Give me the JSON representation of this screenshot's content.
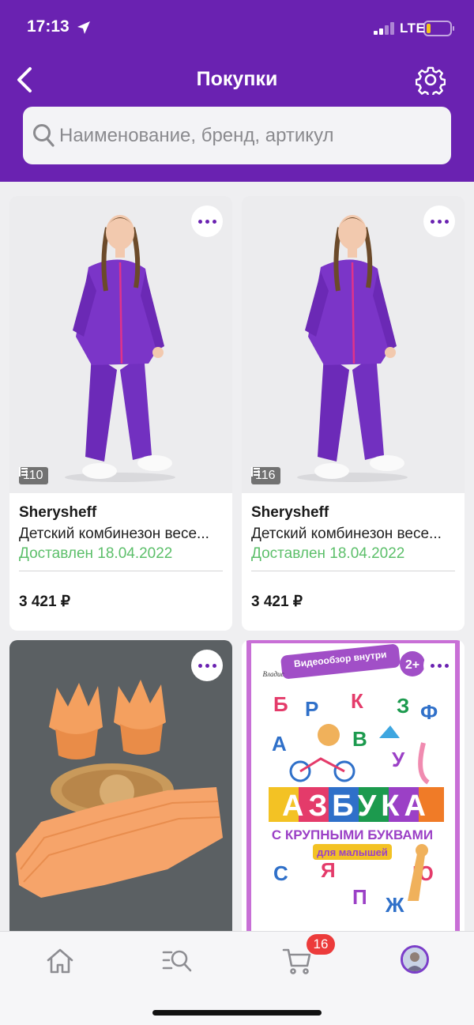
{
  "status_bar": {
    "time": "17:13",
    "network": "LTE",
    "icons": [
      "location-arrow-icon",
      "signal-icon",
      "battery-icon"
    ]
  },
  "header": {
    "title": "Покупки",
    "back_icon": "chevron-left-icon",
    "settings_icon": "gear-icon",
    "accent_color": "#6a22b1"
  },
  "search": {
    "placeholder": "Наименование, бренд, артикул",
    "value": ""
  },
  "products": [
    {
      "brand": "Sherysheff",
      "name": "Детский комбинезон весе...",
      "delivery": "Доставлен 18.04.2022",
      "size": "110",
      "price": "3 421 ₽",
      "image": "girl-purple-jumpsuit"
    },
    {
      "brand": "Sherysheff",
      "name": "Детский комбинезон весе...",
      "delivery": "Доставлен 18.04.2022",
      "size": "116",
      "price": "3 421 ₽",
      "image": "girl-purple-jumpsuit"
    },
    {
      "image": "orange-tulip-cupcake-liners"
    },
    {
      "image": "azbuka-book-cover",
      "cover": {
        "banner": "Видеообзор внутри",
        "age": "2+",
        "title": "АЗБУКА",
        "subtitle": "С КРУПНЫМИ БУКВАМИ",
        "ribbon": "для малышей",
        "publisher": "Владис"
      }
    }
  ],
  "tab_bar": {
    "tabs": [
      "home-icon",
      "catalog-search-icon",
      "cart-icon",
      "profile-avatar"
    ],
    "cart_count": "16",
    "badge_color": "#ec3b3b"
  },
  "colors": {
    "delivered": "#5cbf6a",
    "background": "#efeff1"
  }
}
